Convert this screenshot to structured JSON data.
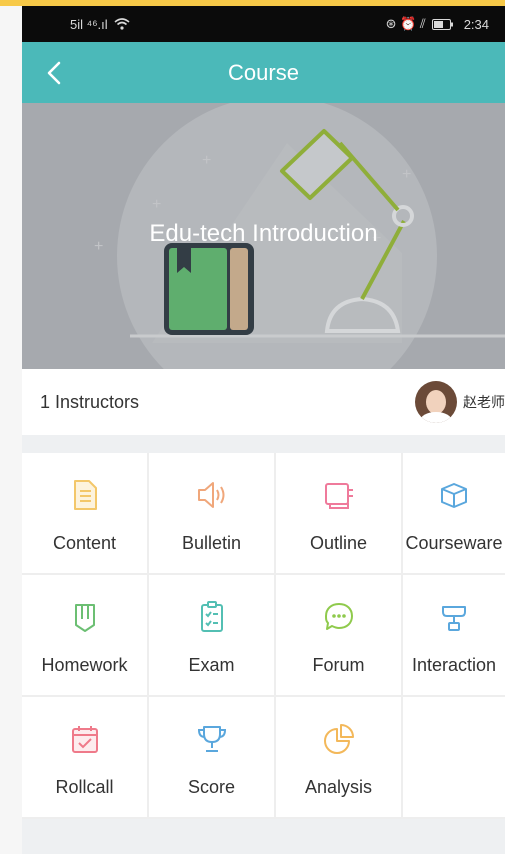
{
  "status_bar": {
    "signal_text": "5il ⁴⁶.ıl",
    "icons_right": "⊛ ⏰ ⫽",
    "time": "2:34"
  },
  "nav": {
    "back_icon": "chevron-left-icon",
    "title": "Course"
  },
  "banner": {
    "title": "Edu-tech Introduction",
    "colors": {
      "background": "#a6a9ae",
      "book": "#5fae6e",
      "lamp": "#8fae3a"
    }
  },
  "instructors": {
    "label": "1 Instructors",
    "teacher_name": "赵老师"
  },
  "menu": [
    {
      "label": "Content",
      "icon": "document-icon",
      "color": "#f3c76a"
    },
    {
      "label": "Bulletin",
      "icon": "speaker-icon",
      "color": "#f0a77b"
    },
    {
      "label": "Outline",
      "icon": "outline-icon",
      "color": "#ef7a9b"
    },
    {
      "label": "Courseware",
      "icon": "box-icon",
      "color": "#5aa7dd"
    },
    {
      "label": "Homework",
      "icon": "homework-icon",
      "color": "#6cbf73"
    },
    {
      "label": "Exam",
      "icon": "clipboard-check-icon",
      "color": "#53bfb3"
    },
    {
      "label": "Forum",
      "icon": "chat-icon",
      "color": "#8fca4c"
    },
    {
      "label": "Interaction",
      "icon": "presentation-icon",
      "color": "#5aa7dd"
    },
    {
      "label": "Rollcall",
      "icon": "calendar-check-icon",
      "color": "#ef7a8a"
    },
    {
      "label": "Score",
      "icon": "trophy-icon",
      "color": "#5aa7dd"
    },
    {
      "label": "Analysis",
      "icon": "pie-chart-icon",
      "color": "#f3b85a"
    }
  ],
  "colors": {
    "accent": "#4bb9b9"
  }
}
